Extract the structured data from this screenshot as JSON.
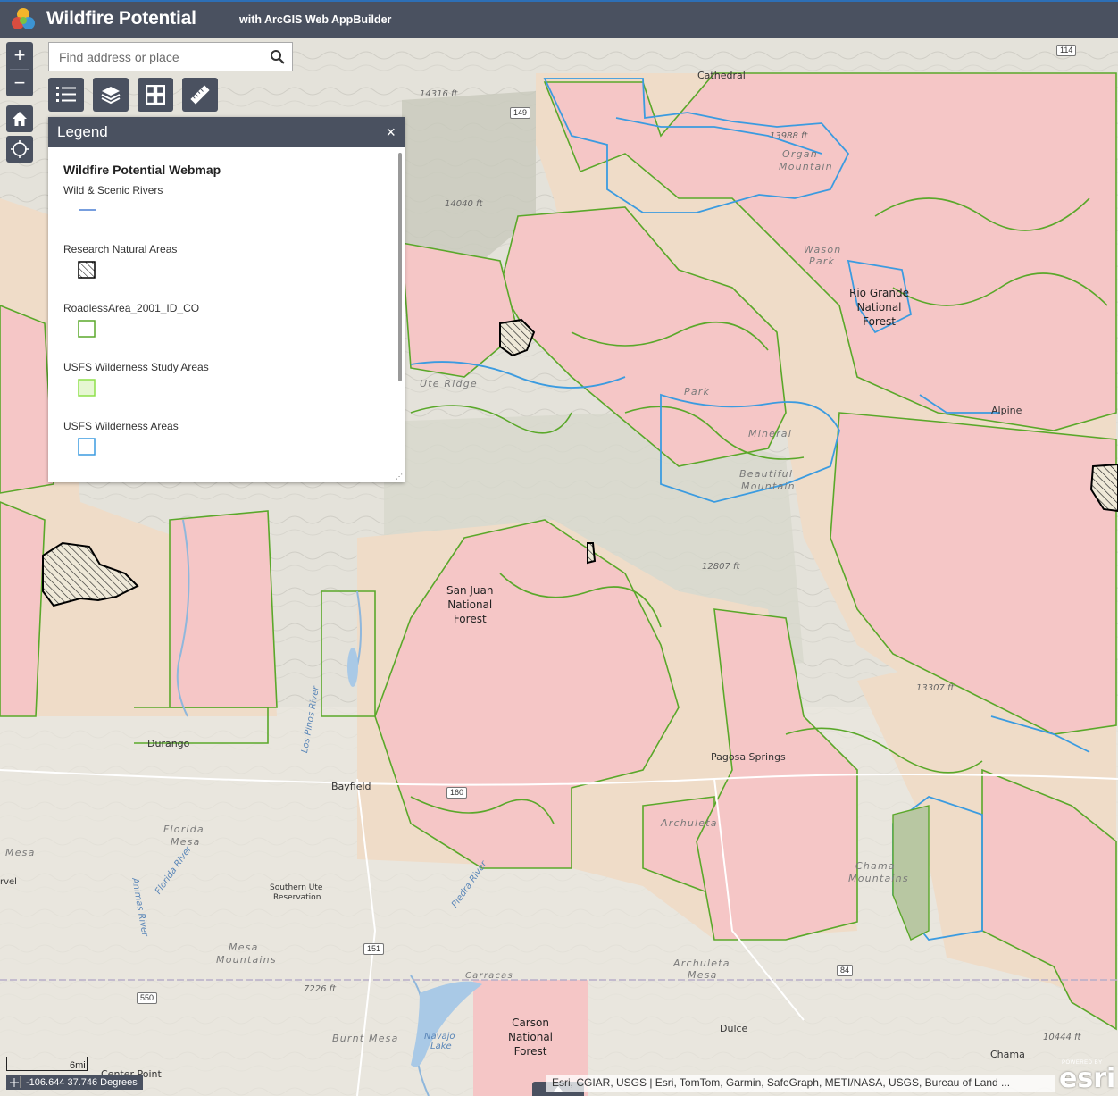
{
  "header": {
    "title": "Wildfire Potential",
    "subtitle": "with ArcGIS Web AppBuilder"
  },
  "search": {
    "placeholder": "Find address or place"
  },
  "controls": {
    "zoom_in": "+",
    "zoom_out": "−"
  },
  "legend": {
    "title": "Legend",
    "close": "×",
    "map_title": "Wildfire Potential Webmap",
    "layers": [
      {
        "name": "Wild & Scenic Rivers",
        "swatch": "line",
        "color": "#4a7fd4"
      },
      {
        "name": "Research Natural Areas",
        "swatch": "hatch",
        "color": "#000000"
      },
      {
        "name": "RoadlessArea_2001_ID_CO",
        "swatch": "box",
        "color": "#5aa82a"
      },
      {
        "name": "USFS Wilderness Study Areas",
        "swatch": "box-fill",
        "color": "#8ee04a"
      },
      {
        "name": "USFS Wilderness Areas",
        "swatch": "box",
        "color": "#3b9be0"
      }
    ]
  },
  "map": {
    "forest_labels": [
      {
        "lines": [
          "Rio Grande",
          "National",
          "Forest"
        ]
      },
      {
        "lines": [
          "San Juan",
          "National",
          "Forest"
        ]
      },
      {
        "lines": [
          "Carson",
          "National",
          "Forest"
        ]
      }
    ],
    "terrain_labels": [
      "Organ",
      "Mountain",
      "Wason",
      "Park",
      "Ute Ridge",
      "Park",
      "Mineral",
      "Beautiful",
      "Mountain",
      "Florida",
      "Mesa",
      "Mesa",
      "Mesa",
      "Mountains",
      "Archuleta",
      "Mesa",
      "Burnt Mesa",
      "Chama",
      "Mountains",
      "Archuleta"
    ],
    "town_labels": [
      "Durango",
      "Bayfield",
      "Pagosa Springs",
      "Dulce",
      "Chama",
      "Carracas",
      "Cathedral",
      "Alpine",
      "Center Point",
      "Southern Ute",
      "Reservation",
      "rvel"
    ],
    "water_labels": [
      "Los Pinos River",
      "Animas River",
      "Florida River",
      "Piedra River",
      "Navajo",
      "Lake"
    ],
    "elevation_labels": [
      "14316 ft",
      "14040 ft",
      "13988 ft",
      "12807 ft",
      "7226 ft",
      "10444 ft",
      "13307 ft"
    ],
    "shields": [
      "149",
      "114",
      "160",
      "151",
      "550",
      "84"
    ]
  },
  "scalebar": {
    "label": "6mi"
  },
  "coordinates": {
    "text": "-106.644 37.746 Degrees"
  },
  "attribution": {
    "text": "Esri, CGIAR, USGS | Esri, TomTom, Garmin, SafeGraph, METI/NASA, USGS, Bureau of Land ..."
  },
  "esri": {
    "powered": "POWERED BY",
    "brand": "esri"
  },
  "colors": {
    "header": "#4a5160",
    "roadless_fill": "#f5c6c6",
    "roadless_outline": "#5aa82a",
    "wilderness_outline": "#3b9be0",
    "tan_fill": "#efdcc8"
  }
}
